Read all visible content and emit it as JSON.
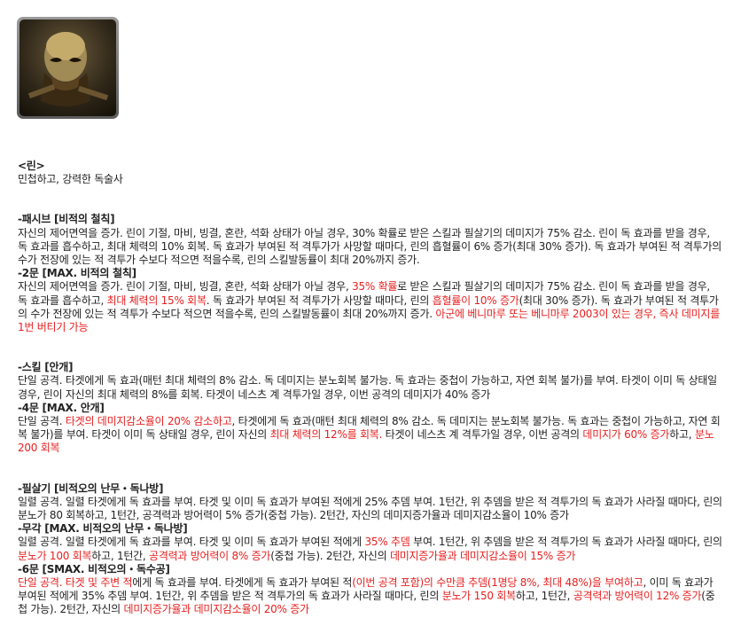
{
  "hero": {
    "name_heading": "<린>",
    "tagline": "민첩하고, 강력한 독술사"
  },
  "passive": {
    "title": "-패시브 [비적의 철칙]",
    "desc": "자신의 제어면역을 증가. 린이 기절, 마비, 빙결, 혼란, 석화 상태가 아닐 경우, 30% 확률로 받은 스킬과 필살기의 데미지가 75% 감소. 린이 독 효과를 받을 경우, 독 효과를 흡수하고, 최대 체력의 10% 회복. 독 효과가 부여된 적 격투가가 사망할 때마다, 린의 흡혈률이 6% 증가(최대 30% 증가). 독 효과가 부여된 적 격투가의 수가 전장에 있는 적 격투가 수보다 적으면 적을수록, 린의 스킬발동률이 최대 20%까지 증가.",
    "max_title": "-2문 [MAX. 비적의 철칙]",
    "max_desc": [
      {
        "t": "자신의 제어면역을 증가. 린이 기절, 마비, 빙결, 혼란, 석화 상태가 아닐 경우, ",
        "r": false
      },
      {
        "t": "35% 확률",
        "r": true
      },
      {
        "t": "로 받은 스킬과 필살기의 데미지가 75% 감소. 린이 독 효과를 받을 경우, 독 효과를 흡수하고, ",
        "r": false
      },
      {
        "t": "최대 체력의 15% 회복",
        "r": true
      },
      {
        "t": ". 독 효과가 부여된 적 격투가가 사망할 때마다, 린의 ",
        "r": false
      },
      {
        "t": "흡혈률이 10% 증가",
        "r": true
      },
      {
        "t": "(최대 30% 증가). 독 효과가 부여된 적 격투가의 수가 전장에 있는 적 격투가 수보다 적으면 적을수록, 린의 스킬발동률이 최대 20%까지 증가. ",
        "r": false
      },
      {
        "t": "아군에 베니마루 또는 베니마루 2003이 있는 경우, 즉사 데미지를 1번 버티기 가능",
        "r": true
      }
    ]
  },
  "skill": {
    "title": "-스킬 [안개]",
    "desc": "단일 공격. 타겟에게 독 효과(매턴 최대 체력의 8% 감소. 독 데미지는 분노회복 불가능. 독 효과는 중첩이 가능하고, 자연 회복 불가)를 부여. 타겟이 이미 독 상태일 경우, 린이 자신의 최대 체력의 8%를 회복. 타겟이 네스츠 계 격투가일 경우, 이번 공격의 데미지가 40% 증가",
    "max_title": "-4문 [MAX. 안개]",
    "max_desc": [
      {
        "t": "단일 공격. ",
        "r": false
      },
      {
        "t": "타겟의 데미지감소율이 20% 감소하고",
        "r": true
      },
      {
        "t": ", 타겟에게 독 효과(매턴 최대 체력의 8% 감소. 독 데미지는 분노회복 불가능. 독 효과는 중첩이 가능하고, 자연 회복 불가)를 부여. 타겟이 이미 독 상태일 경우, 린이 자신의 ",
        "r": false
      },
      {
        "t": "최대 체력의 12%를 회복.",
        "r": true
      },
      {
        "t": " 타겟이 네스츠 계 격투가일 경우, 이번 공격의 ",
        "r": false
      },
      {
        "t": "데미지가 60% 증가",
        "r": true
      },
      {
        "t": "하고, ",
        "r": false
      },
      {
        "t": "분노 200 회복",
        "r": true
      }
    ]
  },
  "ultimate": {
    "title": "-필살기 [비적오의 난무・독나방]",
    "desc": "일렬 공격. 일렬 타겟에게 독 효과를 부여. 타겟 및 이미 독 효과가 부여된 적에게 25% 추뎀 부여. 1턴간, 위 추뎀을 받은 적 격투가의 독 효과가 사라질 때마다, 린의 분노가 80 회복하고, 1턴간, 공격력과 방어력이 5% 증가(중첩 가능). 2턴간, 자신의 데미지증가율과 데미지감소율이 10% 증가",
    "max_title": "-무각 [MAX. 비적오의 난무・독나방]",
    "max_desc": [
      {
        "t": "일렬 공격. 일렬 타겟에게 독 효과를 부여. 타겟 및 이미 독 효과가 부여된 적에게 ",
        "r": false
      },
      {
        "t": "35% 추뎀",
        "r": true
      },
      {
        "t": " 부여. 1턴간, 위 추뎀을 받은 적 격투가의 독 효과가 사라질 때마다, 린의 ",
        "r": false
      },
      {
        "t": "분노가 100 회복",
        "r": true
      },
      {
        "t": "하고, 1턴간, ",
        "r": false
      },
      {
        "t": "공격력과 방어력이 8% 증가",
        "r": true
      },
      {
        "t": "(중첩 가능). 2턴간, 자신의 ",
        "r": false
      },
      {
        "t": "데미지증가율과 데미지감소율이 15% 증가",
        "r": true
      }
    ],
    "smax_title": "-6문 [SMAX. 비적오의・독수공]",
    "smax_desc": [
      {
        "t": "단일 공격. 타겟 및 주변 적",
        "r": true
      },
      {
        "t": "에게 독 효과를 부여. 타겟에게 독 효과가 부여된 적",
        "r": false
      },
      {
        "t": "(이번 공격 포함)의 수만큼 추뎀(1명당 8%, 최대 48%)을 부여하고",
        "r": true
      },
      {
        "t": ", 이미 독 효과가 부여된 적에게 35% 추뎀 부여. 1턴간, 위 추뎀을 받은 적 격투가의 독 효과가 사라질 때마다, 린의 ",
        "r": false
      },
      {
        "t": "분노가 150 회복",
        "r": true
      },
      {
        "t": "하고, 1턴간, ",
        "r": false
      },
      {
        "t": "공격력과 방어력이 12% 증가",
        "r": true
      },
      {
        "t": "(중첩 가능). 2턴간, 자신의 ",
        "r": false
      },
      {
        "t": "데미지증가율과 데미지감소율이 20% 증가",
        "r": true
      }
    ]
  }
}
